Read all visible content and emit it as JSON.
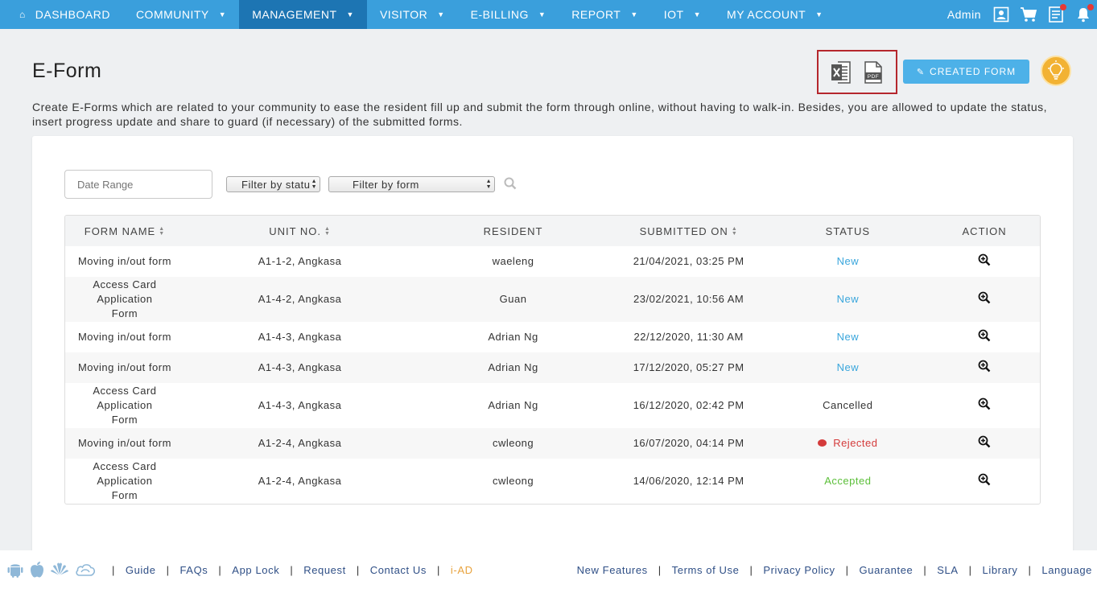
{
  "nav": {
    "items": [
      {
        "label": "DASHBOARD",
        "has_caret": false,
        "active": false
      },
      {
        "label": "COMMUNITY",
        "has_caret": true,
        "active": false
      },
      {
        "label": "MANAGEMENT",
        "has_caret": true,
        "active": true
      },
      {
        "label": "VISITOR",
        "has_caret": true,
        "active": false
      },
      {
        "label": "E-BILLING",
        "has_caret": true,
        "active": false
      },
      {
        "label": "REPORT",
        "has_caret": true,
        "active": false
      },
      {
        "label": "IOT",
        "has_caret": true,
        "active": false
      },
      {
        "label": "MY ACCOUNT",
        "has_caret": true,
        "active": false
      }
    ],
    "user": "Admin",
    "icons": [
      "profile-icon",
      "cart-icon",
      "notes-icon",
      "notification-bell-icon"
    ]
  },
  "page": {
    "title": "E-Form",
    "description": "Create E-Forms which are related to your community to ease the resident fill up and submit the form through online, without having to walk-in. Besides, you are allowed to update the status, insert progress update and share to guard (if necessary) of the submitted forms.",
    "create_button": "CREATED FORM"
  },
  "filters": {
    "date_placeholder": "Date Range",
    "status_select": "Filter by statu",
    "form_select": "Filter by form"
  },
  "table": {
    "headers": [
      "FORM NAME",
      "UNIT NO.",
      "RESIDENT",
      "SUBMITTED ON",
      "STATUS",
      "ACTION"
    ],
    "rows": [
      {
        "form": "Moving in/out form",
        "unit": "A1-1-2, Angkasa",
        "resident": "waeleng",
        "submitted": "21/04/2021, 03:25 PM",
        "status": "New",
        "status_class": "new",
        "tall": false
      },
      {
        "form": "Access Card Application Form",
        "unit": "A1-4-2, Angkasa",
        "resident": "Guan",
        "submitted": "23/02/2021, 10:56 AM",
        "status": "New",
        "status_class": "new",
        "tall": true
      },
      {
        "form": "Moving in/out form",
        "unit": "A1-4-3, Angkasa",
        "resident": "Adrian Ng",
        "submitted": "22/12/2020, 11:30 AM",
        "status": "New",
        "status_class": "new",
        "tall": false
      },
      {
        "form": "Moving in/out form",
        "unit": "A1-4-3, Angkasa",
        "resident": "Adrian Ng",
        "submitted": "17/12/2020, 05:27 PM",
        "status": "New",
        "status_class": "new",
        "tall": false
      },
      {
        "form": "Access Card Application Form",
        "unit": "A1-4-3, Angkasa",
        "resident": "Adrian Ng",
        "submitted": "16/12/2020, 02:42 PM",
        "status": "Cancelled",
        "status_class": "cancelled",
        "tall": true
      },
      {
        "form": "Moving in/out form",
        "unit": "A1-2-4, Angkasa",
        "resident": "cwleong",
        "submitted": "16/07/2020, 04:14 PM",
        "status": "Rejected",
        "status_class": "rejected",
        "tall": false
      },
      {
        "form": "Access Card Application Form",
        "unit": "A1-2-4, Angkasa",
        "resident": "cwleong",
        "submitted": "14/06/2020, 12:14 PM",
        "status": "Accepted",
        "status_class": "accepted",
        "tall": true
      }
    ]
  },
  "footer": {
    "left_links": [
      "Guide",
      "FAQs",
      "App Lock",
      "Request",
      "Contact Us",
      "i-AD"
    ],
    "right_links": [
      "New Features",
      "Terms of Use",
      "Privacy Policy",
      "Guarantee",
      "SLA",
      "Library",
      "Language"
    ],
    "platform_icons": [
      "android-icon",
      "apple-icon",
      "huawei-icon",
      "cloud-icon"
    ]
  },
  "colors": {
    "nav_bg": "#3a9fdc",
    "nav_active": "#1d75b3",
    "status_new": "#3aa6dc",
    "status_rejected": "#d43b3b",
    "status_accepted": "#5cbf3a",
    "export_border": "#b5272d"
  }
}
